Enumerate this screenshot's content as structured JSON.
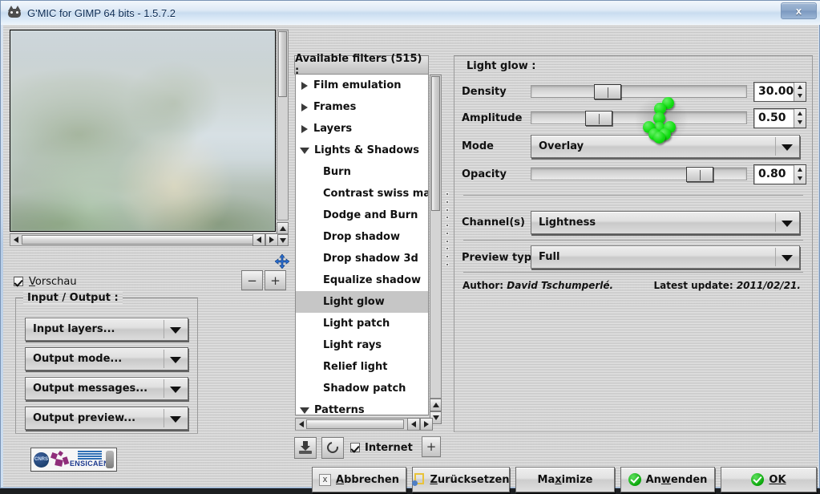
{
  "window": {
    "title": "G'MIC for GIMP 64 bits - 1.5.7.2",
    "close_label": "x",
    "icon": "gimp-wilber-icon"
  },
  "preview": {
    "checkbox_label_pre": "V",
    "checkbox_label_post": "orschau",
    "checkbox_checked": true,
    "zoom_out_label": "−",
    "zoom_in_label": "+"
  },
  "io_group": {
    "legend": "Input / Output :",
    "buttons": [
      {
        "label": "Input layers..."
      },
      {
        "label": "Output mode..."
      },
      {
        "label": "Output messages..."
      },
      {
        "label": "Output preview..."
      }
    ]
  },
  "logo": {
    "cnrs_text": "CNRS",
    "ensicaen_text": "ENSICAEN"
  },
  "filters": {
    "header": "Available filters (515) :",
    "items": [
      {
        "label": "Film emulation",
        "type": "collapsed",
        "indent": 0
      },
      {
        "label": "Frames",
        "type": "collapsed",
        "indent": 0
      },
      {
        "label": "Layers",
        "type": "collapsed",
        "indent": 0
      },
      {
        "label": "Lights & Shadows",
        "type": "expanded",
        "indent": 0
      },
      {
        "label": "Burn",
        "type": "leaf",
        "indent": 1
      },
      {
        "label": "Contrast swiss mask",
        "type": "leaf",
        "indent": 1
      },
      {
        "label": "Dodge and Burn",
        "type": "leaf",
        "indent": 1
      },
      {
        "label": "Drop shadow",
        "type": "leaf",
        "indent": 1
      },
      {
        "label": "Drop shadow 3d",
        "type": "leaf",
        "indent": 1
      },
      {
        "label": "Equalize shadow",
        "type": "leaf",
        "indent": 1
      },
      {
        "label": "Light glow",
        "type": "leaf",
        "indent": 1,
        "selected": true
      },
      {
        "label": "Light patch",
        "type": "leaf",
        "indent": 1
      },
      {
        "label": "Light rays",
        "type": "leaf",
        "indent": 1
      },
      {
        "label": "Relief light",
        "type": "leaf",
        "indent": 1
      },
      {
        "label": "Shadow patch",
        "type": "leaf",
        "indent": 1
      },
      {
        "label": "Patterns",
        "type": "expanded",
        "indent": 0
      }
    ],
    "toolbar": {
      "internet_label": "Internet",
      "internet_checked": true,
      "add_label": "+"
    }
  },
  "filter_panel": {
    "legend": "Light glow :",
    "params": [
      {
        "name": "Density",
        "value": "30.00",
        "slider_pct": 29
      },
      {
        "name": "Amplitude",
        "value": "0.50",
        "slider_pct": 25
      },
      {
        "name": "Opacity",
        "value": "0.80",
        "slider_pct": 72
      }
    ],
    "mode": {
      "label": "Mode",
      "value": "Overlay"
    },
    "channels": {
      "label": "Channel(s)",
      "value": "Lightness"
    },
    "preview_type": {
      "label": "Preview type",
      "value": "Full"
    },
    "author_prefix": "Author:",
    "author_name": "David Tschumperlé.",
    "update_prefix": "Latest update:",
    "update_value": "2011/02/21."
  },
  "bottom_buttons": [
    {
      "mn_pre": "",
      "mn": "A",
      "mn_post": "bbrechen",
      "icon": "close-x-icon",
      "width": 118
    },
    {
      "mn_pre": "",
      "mn": "Z",
      "mn_post": "urücksetzen",
      "icon": "reset-icon",
      "width": 122
    },
    {
      "mn_pre": "Ma",
      "mn": "x",
      "mn_post": "imize",
      "icon": "none",
      "width": 124
    },
    {
      "mn_pre": "An",
      "mn": "w",
      "mn_post": "enden",
      "icon": "check-icon",
      "width": 118
    },
    {
      "mn_pre": "",
      "mn": "O",
      "mn_post": "K",
      "icon": "check-icon",
      "width": 120
    }
  ],
  "colors": {
    "accent_green": "#13df13",
    "title_text": "#0c2c54",
    "panel_bg": "#cfcfcf",
    "selection": "#c6c6c6"
  }
}
